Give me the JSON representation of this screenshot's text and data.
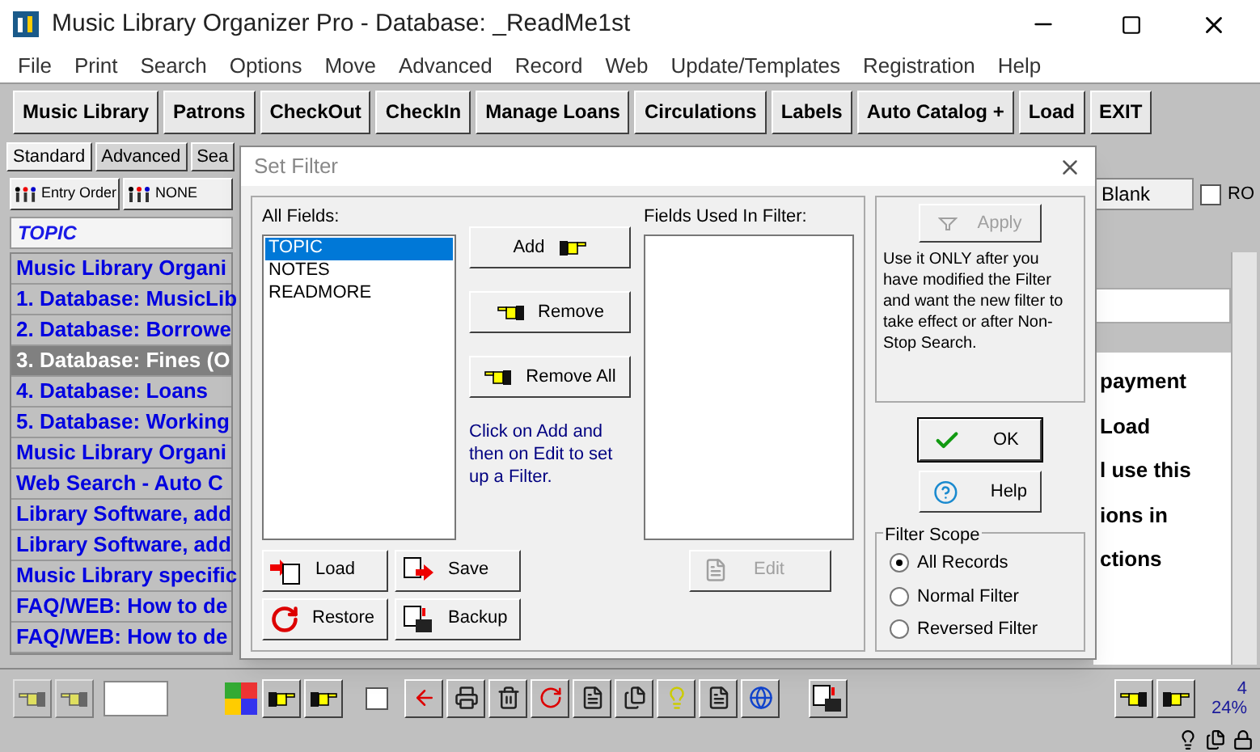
{
  "window": {
    "title": "Music Library Organizer Pro - Database: _ReadMe1st"
  },
  "menu": [
    "File",
    "Print",
    "Search",
    "Options",
    "Move",
    "Advanced",
    "Record",
    "Web",
    "Update/Templates",
    "Registration",
    "Help"
  ],
  "toolbar": [
    "Music Library",
    "Patrons",
    "CheckOut",
    "CheckIn",
    "Manage Loans",
    "Circulations",
    "Labels",
    "Auto Catalog +",
    "Load",
    "EXIT"
  ],
  "view_tabs": [
    {
      "label": "Standard",
      "selected": true
    },
    {
      "label": "Advanced",
      "selected": false
    },
    {
      "label": "Sea",
      "selected": false
    }
  ],
  "sort_buttons": [
    "Entry Order",
    "NONE"
  ],
  "list": {
    "header": "TOPIC",
    "rows": [
      {
        "label": "Music Library Organi",
        "selected": false
      },
      {
        "label": "1. Database: MusicLib",
        "selected": false
      },
      {
        "label": "2. Database: Borrowe",
        "selected": false
      },
      {
        "label": "3. Database: Fines (O",
        "selected": true
      },
      {
        "label": "4. Database: Loans",
        "selected": false
      },
      {
        "label": "5. Database: Working",
        "selected": false
      },
      {
        "label": "Music Library Organi",
        "selected": false
      },
      {
        "label": "Web Search - Auto C",
        "selected": false
      },
      {
        "label": "Library Software, add",
        "selected": false
      },
      {
        "label": "Library Software, add",
        "selected": false
      },
      {
        "label": "Music Library specific",
        "selected": false
      },
      {
        "label": "FAQ/WEB: How to de",
        "selected": false
      },
      {
        "label": "FAQ/WEB: How to de",
        "selected": false
      }
    ]
  },
  "right_panel": {
    "field": "Blank",
    "ro": {
      "label": "RO",
      "checked": false
    },
    "text_lines": [
      "payment",
      "Load",
      "l use this",
      "ions in",
      "ctions"
    ]
  },
  "dialog": {
    "title": "Set Filter",
    "all_fields": {
      "label": "All Fields:",
      "items": [
        {
          "label": "TOPIC",
          "selected": true
        },
        {
          "label": "NOTES",
          "selected": false
        },
        {
          "label": "READMORE",
          "selected": false
        }
      ]
    },
    "fields_used": {
      "label": "Fields Used In Filter:"
    },
    "move_buttons": [
      {
        "label": "Add",
        "kind": "add"
      },
      {
        "label": "Remove",
        "kind": "remove"
      },
      {
        "label": "Remove All",
        "kind": "remove"
      }
    ],
    "hint": "Click on Add and then on Edit to set up a Filter.",
    "edit_button": {
      "label": "Edit",
      "disabled": true
    },
    "file_buttons": [
      {
        "label": "Load",
        "kind": "load"
      },
      {
        "label": "Save",
        "kind": "save"
      },
      {
        "label": "Restore",
        "kind": "restore"
      },
      {
        "label": "Backup",
        "kind": "backup"
      }
    ],
    "apply_button": {
      "label": "Apply",
      "disabled": true
    },
    "apply_note": "Use it ONLY after you have modified the Filter and want the new filter to take effect or after Non-Stop Search.",
    "ok_button": "OK",
    "help_button": "Help",
    "filter_scope": {
      "label": "Filter Scope",
      "options": [
        {
          "label": "All Records",
          "selected": true
        },
        {
          "label": "Normal Filter",
          "selected": false
        },
        {
          "label": "Reversed Filter",
          "selected": false
        }
      ]
    }
  },
  "bottom_checkbox": {
    "checked": false
  },
  "status": {
    "record": "4",
    "percent": "24%"
  }
}
